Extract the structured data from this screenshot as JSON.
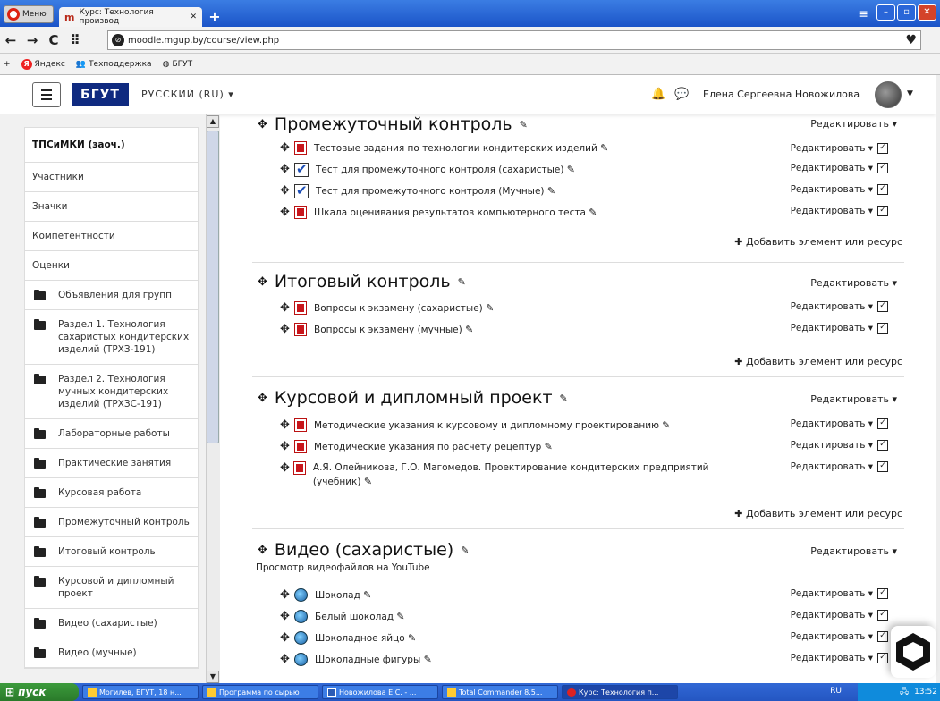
{
  "browser": {
    "menu_label": "Меню",
    "tab_title": "Курс: Технология производ",
    "tab_favicon": "m",
    "url": "moodle.mgup.by/course/view.php",
    "bookmarks": [
      {
        "label": "Яндекс",
        "icon": "yandex-icon"
      },
      {
        "label": "Техподдержка",
        "icon": "support-icon"
      },
      {
        "label": "БГУТ",
        "icon": "bgut-icon"
      }
    ]
  },
  "header": {
    "brand": "БГУТ",
    "language": "РУССКИЙ (RU) ▾",
    "user_name": "Елена Сергеевна Новожилова"
  },
  "sidebar": {
    "course_short": "ТПСиМКИ (заоч.)",
    "nav": [
      "Участники",
      "Значки",
      "Компетентности",
      "Оценки"
    ],
    "sections": [
      "Объявления для групп",
      "Раздел 1. Технология сахаристых кондитерских изделий (ТРХЗ-191)",
      "Раздел 2. Технология мучных кондитерских изделий (ТРХЗС-191)",
      "Лабораторные работы",
      "Практические занятия",
      "Курсовая работа",
      "Промежуточный контроль",
      "Итоговый контроль",
      "Курсовой и дипломный проект",
      "Видео (сахаристые)",
      "Видео (мучные)"
    ]
  },
  "labels": {
    "edit": "Редактировать ▾",
    "add_resource": "Добавить элемент или ресурс"
  },
  "main": {
    "sections": [
      {
        "title": "Промежуточный контроль",
        "activities": [
          {
            "type": "pdf",
            "label": "Тестовые задания по технологии кондитерских изделий"
          },
          {
            "type": "quiz",
            "label": "Тест для промежуточного контроля (сахаристые)"
          },
          {
            "type": "quiz",
            "label": "Тест для промежуточного контроля (Мучные)"
          },
          {
            "type": "pdf",
            "label": "Шкала оценивания результатов компьютерного теста"
          }
        ]
      },
      {
        "title": "Итоговый контроль",
        "activities": [
          {
            "type": "pdf",
            "label": "Вопросы к экзамену (сахаристые)"
          },
          {
            "type": "pdf",
            "label": "Вопросы к экзамену (мучные)"
          }
        ]
      },
      {
        "title": "Курсовой и дипломный проект",
        "activities": [
          {
            "type": "pdf",
            "label": "Методические указания к курсовому и дипломному проектированию"
          },
          {
            "type": "pdf",
            "label": "Методические указания по расчету рецептур"
          },
          {
            "type": "pdf",
            "label": "А.Я. Олейникова, Г.О. Магомедов. Проектирование кондитерских предприятий (учебник)"
          }
        ]
      },
      {
        "title": "Видео (сахаристые)",
        "summary": "Просмотр видеофайлов на YouTube",
        "activities": [
          {
            "type": "url",
            "label": "Шоколад"
          },
          {
            "type": "url",
            "label": "Белый шоколад"
          },
          {
            "type": "url",
            "label": "Шоколадное яйцо"
          },
          {
            "type": "url",
            "label": "Шоколадные фигуры"
          }
        ]
      }
    ]
  },
  "taskbar": {
    "start": "пуск",
    "tasks": [
      "Могилев, БГУТ, 18 н...",
      "Программа по сырью",
      "Новожилова Е.С. - ...",
      "Total Commander 8.5...",
      "Курс: Технология п..."
    ],
    "lang": "RU",
    "clock": "13:52"
  }
}
